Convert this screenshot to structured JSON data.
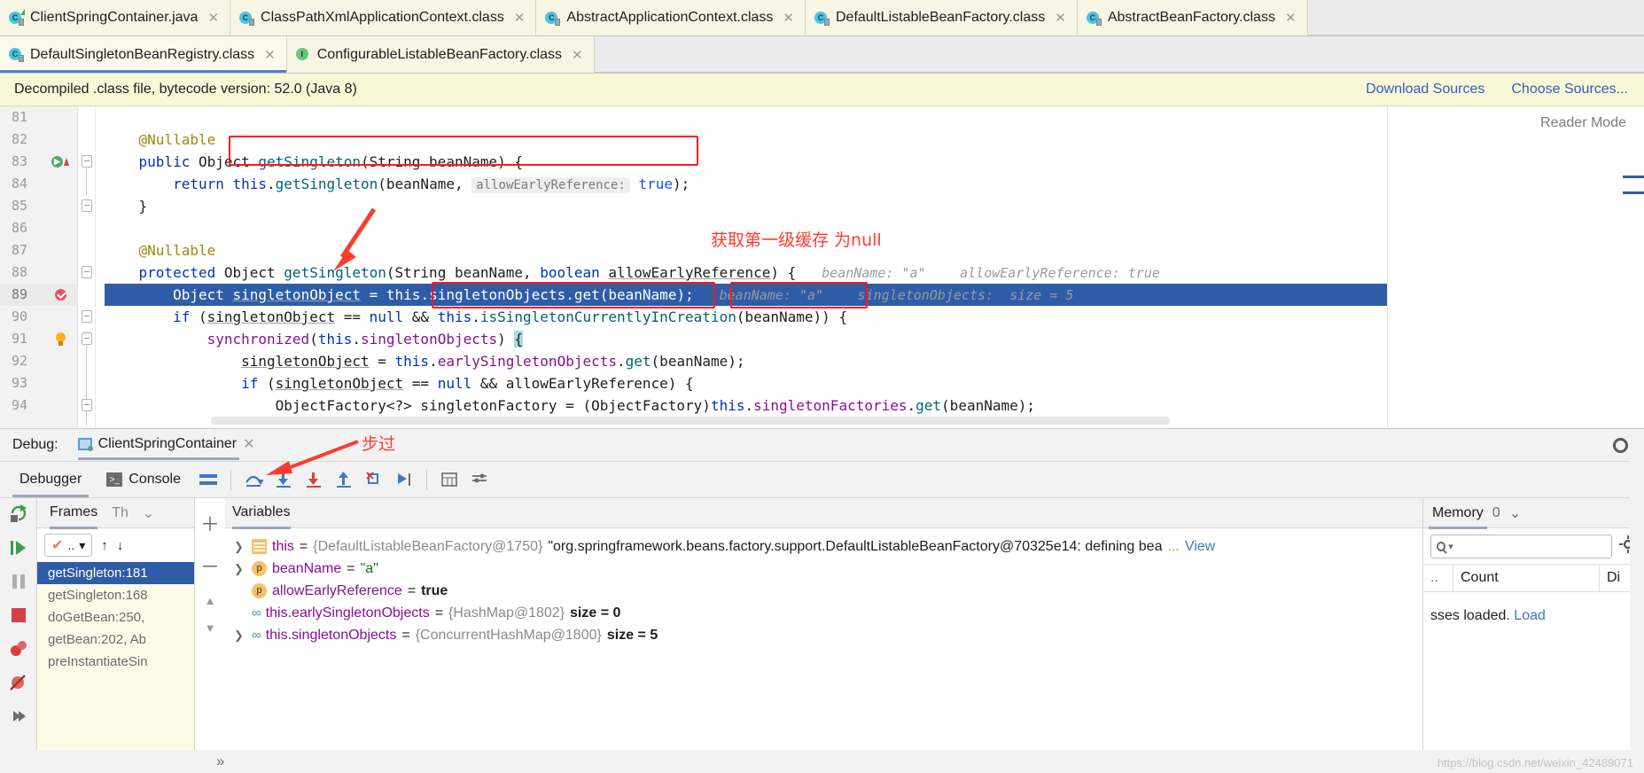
{
  "editor_tabs_row1": [
    {
      "label": "ClientSpringContainer.java",
      "icon": "java-class-icon",
      "kind": "java"
    },
    {
      "label": "ClassPathXmlApplicationContext.class",
      "icon": "class-file-icon",
      "kind": "class"
    },
    {
      "label": "AbstractApplicationContext.class",
      "icon": "class-file-icon",
      "kind": "class"
    },
    {
      "label": "DefaultListableBeanFactory.class",
      "icon": "class-file-icon",
      "kind": "class"
    },
    {
      "label": "AbstractBeanFactory.class",
      "icon": "class-file-icon",
      "kind": "class"
    }
  ],
  "editor_tabs_row2": [
    {
      "label": "DefaultSingletonBeanRegistry.class",
      "icon": "class-file-icon",
      "kind": "class",
      "selected": true
    },
    {
      "label": "ConfigurableListableBeanFactory.class",
      "icon": "interface-file-icon",
      "kind": "interface"
    }
  ],
  "notice": {
    "message": "Decompiled .class file, bytecode version: 52.0 (Java 8)",
    "download_sources": "Download Sources",
    "choose_sources": "Choose Sources..."
  },
  "editor": {
    "reader_mode_label": "Reader Mode",
    "lines": [
      {
        "num": "81",
        "text": ""
      },
      {
        "num": "82",
        "text": "    @Nullable"
      },
      {
        "num": "83",
        "text": "    public Object getSingleton(String beanName) {"
      },
      {
        "num": "84",
        "text": "        return this.getSingleton(beanName,  allowEarlyReference: true);"
      },
      {
        "num": "85",
        "text": "    }"
      },
      {
        "num": "86",
        "text": ""
      },
      {
        "num": "87",
        "text": "    @Nullable"
      },
      {
        "num": "88",
        "text": "    protected Object getSingleton(String beanName, boolean allowEarlyReference) {   beanName: \"a\"    allowEarlyReference: true"
      },
      {
        "num": "89",
        "text": "        Object singletonObject = this.singletonObjects.get(beanName);   beanName: \"a\"    singletonObjects:  size = 5"
      },
      {
        "num": "90",
        "text": "        if (singletonObject == null && this.isSingletonCurrentlyInCreation(beanName)) {"
      },
      {
        "num": "91",
        "text": "            synchronized(this.singletonObjects) {"
      },
      {
        "num": "92",
        "text": "                singletonObject = this.earlySingletonObjects.get(beanName);"
      },
      {
        "num": "93",
        "text": "                if (singletonObject == null && allowEarlyReference) {"
      },
      {
        "num": "94",
        "text": "                    ObjectFactory<?> singletonFactory = (ObjectFactory)this.singletonFactories.get(beanName);"
      }
    ],
    "inlay_hints": {
      "allow_early_reference_param": "allowEarlyReference:",
      "bean_name_hint": "beanName: \"a\"",
      "allow_early_reference_hint": "allowEarlyReference: true",
      "singleton_objects_hint": "singletonObjects:  size = 5",
      "bean_name_hint_89": "beanName: \"a\""
    }
  },
  "annotations": {
    "cache_note": "获取第一级缓存 为null",
    "step_over_note": "步过",
    "color": "#ff3b30"
  },
  "debug": {
    "label": "Debug:",
    "session_name": "ClientSpringContainer",
    "tabs": [
      {
        "label": "Debugger",
        "active": true
      },
      {
        "label": "Console",
        "active": false
      }
    ],
    "toolbar_icons": [
      "rerun-icon",
      "layout-icon",
      "step-over-icon",
      "step-into-icon",
      "force-step-into-icon",
      "step-out-icon",
      "drop-frame-icon",
      "run-to-cursor-icon",
      "evaluate-expression-icon",
      "settings-icon"
    ],
    "left_strip_icons": [
      "rerun-debug-icon",
      "resume-program-icon",
      "pause-program-icon",
      "stop-icon",
      "view-breakpoints-icon",
      "mute-breakpoints-icon",
      "restore-layout-icon"
    ],
    "frames": {
      "tab_frames": "Frames",
      "tab_threads": "Th",
      "thread_selector": "..",
      "items": [
        {
          "label": "getSingleton:181",
          "selected": true
        },
        {
          "label": "getSingleton:168",
          "selected": false
        },
        {
          "label": "doGetBean:250,",
          "selected": false
        },
        {
          "label": "getBean:202, Ab",
          "selected": false
        },
        {
          "label": "preInstantiateSin",
          "selected": false
        }
      ]
    },
    "variables": {
      "title": "Variables",
      "rows": [
        {
          "expandable": true,
          "badge": "object",
          "name": "this",
          "eq": " = ",
          "value": "{DefaultListableBeanFactory@1750}",
          "detail": "\"org.springframework.beans.factory.support.DefaultListableBeanFactory@70325e14: defining bea",
          "ellipsis": "...",
          "link": "View"
        },
        {
          "expandable": true,
          "badge": "p",
          "name": "beanName",
          "eq": " = ",
          "value": "",
          "str": "\"a\"",
          "detail": "",
          "ellipsis": "",
          "link": ""
        },
        {
          "expandable": false,
          "badge": "p",
          "name": "allowEarlyReference",
          "eq": " = ",
          "value": "",
          "bool": "true",
          "detail": "",
          "ellipsis": "",
          "link": ""
        },
        {
          "expandable": false,
          "badge": "oo",
          "name": "this.earlySingletonObjects",
          "eq": " = ",
          "value": "{HashMap@1802}",
          "size": "size = 0",
          "detail": "",
          "ellipsis": "",
          "link": ""
        },
        {
          "expandable": true,
          "badge": "oo",
          "name": "this.singletonObjects",
          "eq": " = ",
          "value": "{ConcurrentHashMap@1800}",
          "size": "size = 5",
          "detail": "",
          "ellipsis": "",
          "link": ""
        }
      ]
    },
    "memory": {
      "tab_label": "Memory",
      "count_badge": "0",
      "search_placeholder": "",
      "columns": [
        "..",
        "Count",
        "Di"
      ],
      "note": "sses loaded.",
      "note_link": "Load"
    }
  },
  "watermark": "https://blog.csdn.net/weixin_42489071"
}
